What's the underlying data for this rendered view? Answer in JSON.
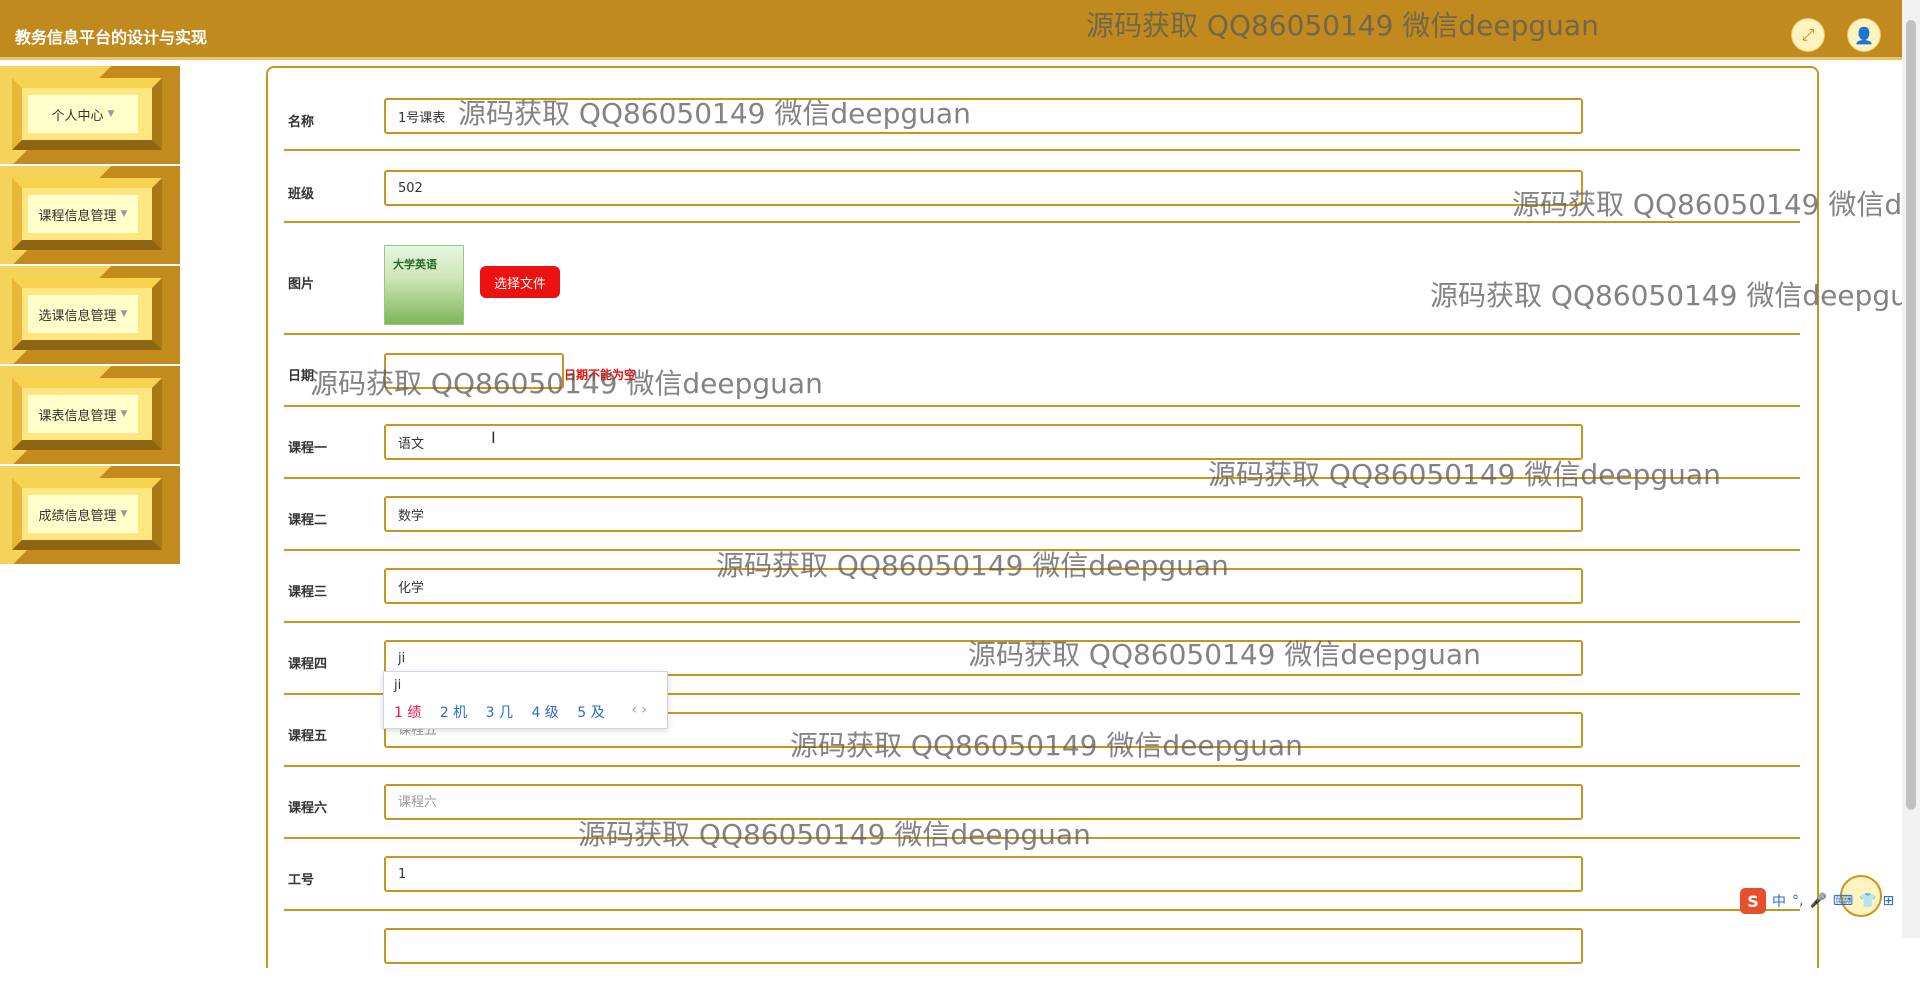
{
  "app": {
    "title": "教务信息平台的设计与实现"
  },
  "header": {
    "fullscreen_icon": "expand-icon",
    "user_icon": "user-icon"
  },
  "sidebar": {
    "items": [
      {
        "label": "个人中心"
      },
      {
        "label": "课程信息管理"
      },
      {
        "label": "选课信息管理"
      },
      {
        "label": "课表信息管理"
      },
      {
        "label": "成绩信息管理"
      }
    ]
  },
  "form": {
    "name": {
      "label": "名称",
      "value": "1号课表"
    },
    "class": {
      "label": "班级",
      "value": "502"
    },
    "image": {
      "label": "图片",
      "button": "选择文件",
      "thumb_text": "大学英语"
    },
    "date": {
      "label": "日期",
      "error": "日期不能为空"
    },
    "course1": {
      "label": "课程一",
      "value": "语文"
    },
    "course2": {
      "label": "课程二",
      "value": "数学"
    },
    "course3": {
      "label": "课程三",
      "value": "化学"
    },
    "course4": {
      "label": "课程四",
      "value": "ji"
    },
    "course5": {
      "label": "课程五",
      "placeholder": "课程五"
    },
    "course6": {
      "label": "课程六",
      "placeholder": "课程六"
    },
    "job_no": {
      "label": "工号",
      "value": "1"
    }
  },
  "ime": {
    "composition": "ji",
    "candidates": [
      "1 绩",
      "2 机",
      "3 几",
      "4 级",
      "5 及"
    ],
    "arrows": "‹ ›",
    "tray": [
      "中",
      "°,",
      "🎤",
      "⌨",
      "👕",
      "⊞"
    ]
  },
  "watermark": "源码获取 QQ86050149 微信deepguan"
}
